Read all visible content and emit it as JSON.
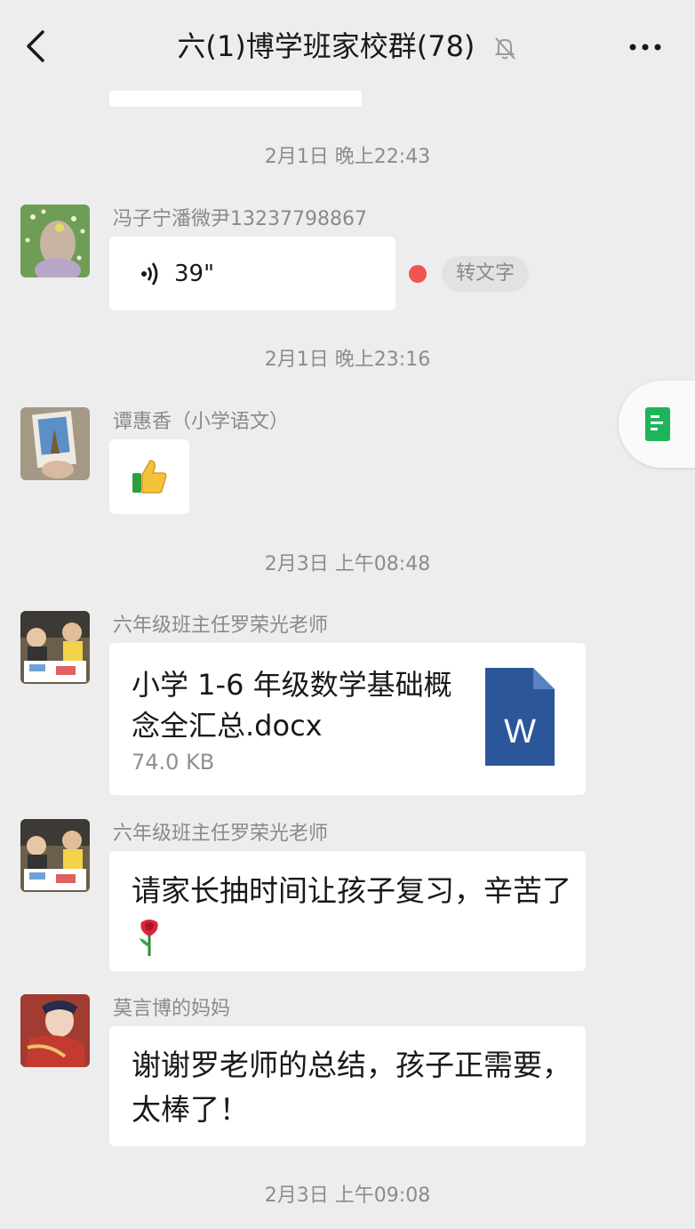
{
  "header": {
    "title": "六(1)博学班家校群(78)",
    "back_icon": "chevron-left-icon",
    "mute_icon": "bell-off-icon",
    "more_icon": "more-icon"
  },
  "messages": [
    {
      "timestamp": "2月1日 晚上22:43"
    },
    {
      "sender": "冯子宁潘微尹13237798867",
      "voice_duration": "39\"",
      "unread_dot_color": "#f25453",
      "transcribe_label": "转文字"
    },
    {
      "timestamp": "2月1日 晚上23:16"
    },
    {
      "sender": "谭惠香（小学语文）",
      "emoji": "thumbs-up"
    },
    {
      "timestamp": "2月3日 上午08:48"
    },
    {
      "sender": "六年级班主任罗荣光老师",
      "file_name": "小学 1-6 年级数学基础概念全汇总.docx",
      "file_name_line1": "小学 1-6 年级数学基础概",
      "file_name_line2": "念全汇总.docx",
      "file_size": "74.0 KB",
      "file_icon": "word-doc-icon"
    },
    {
      "sender": "六年级班主任罗荣光老师",
      "text": "请家长抽时间让孩子复习，辛苦了",
      "emoji": "rose"
    },
    {
      "sender": "莫言博的妈妈",
      "text_line1": "谢谢罗老师的总结，孩子正需要，",
      "text_line2": "太棒了！"
    },
    {
      "timestamp": "2月3日 上午09:08"
    }
  ],
  "floating": {
    "icon": "note-doc-icon",
    "color": "#1fb35a"
  },
  "colors": {
    "background": "#ededed",
    "bubble": "#ffffff",
    "word_blue": "#2b579a"
  }
}
